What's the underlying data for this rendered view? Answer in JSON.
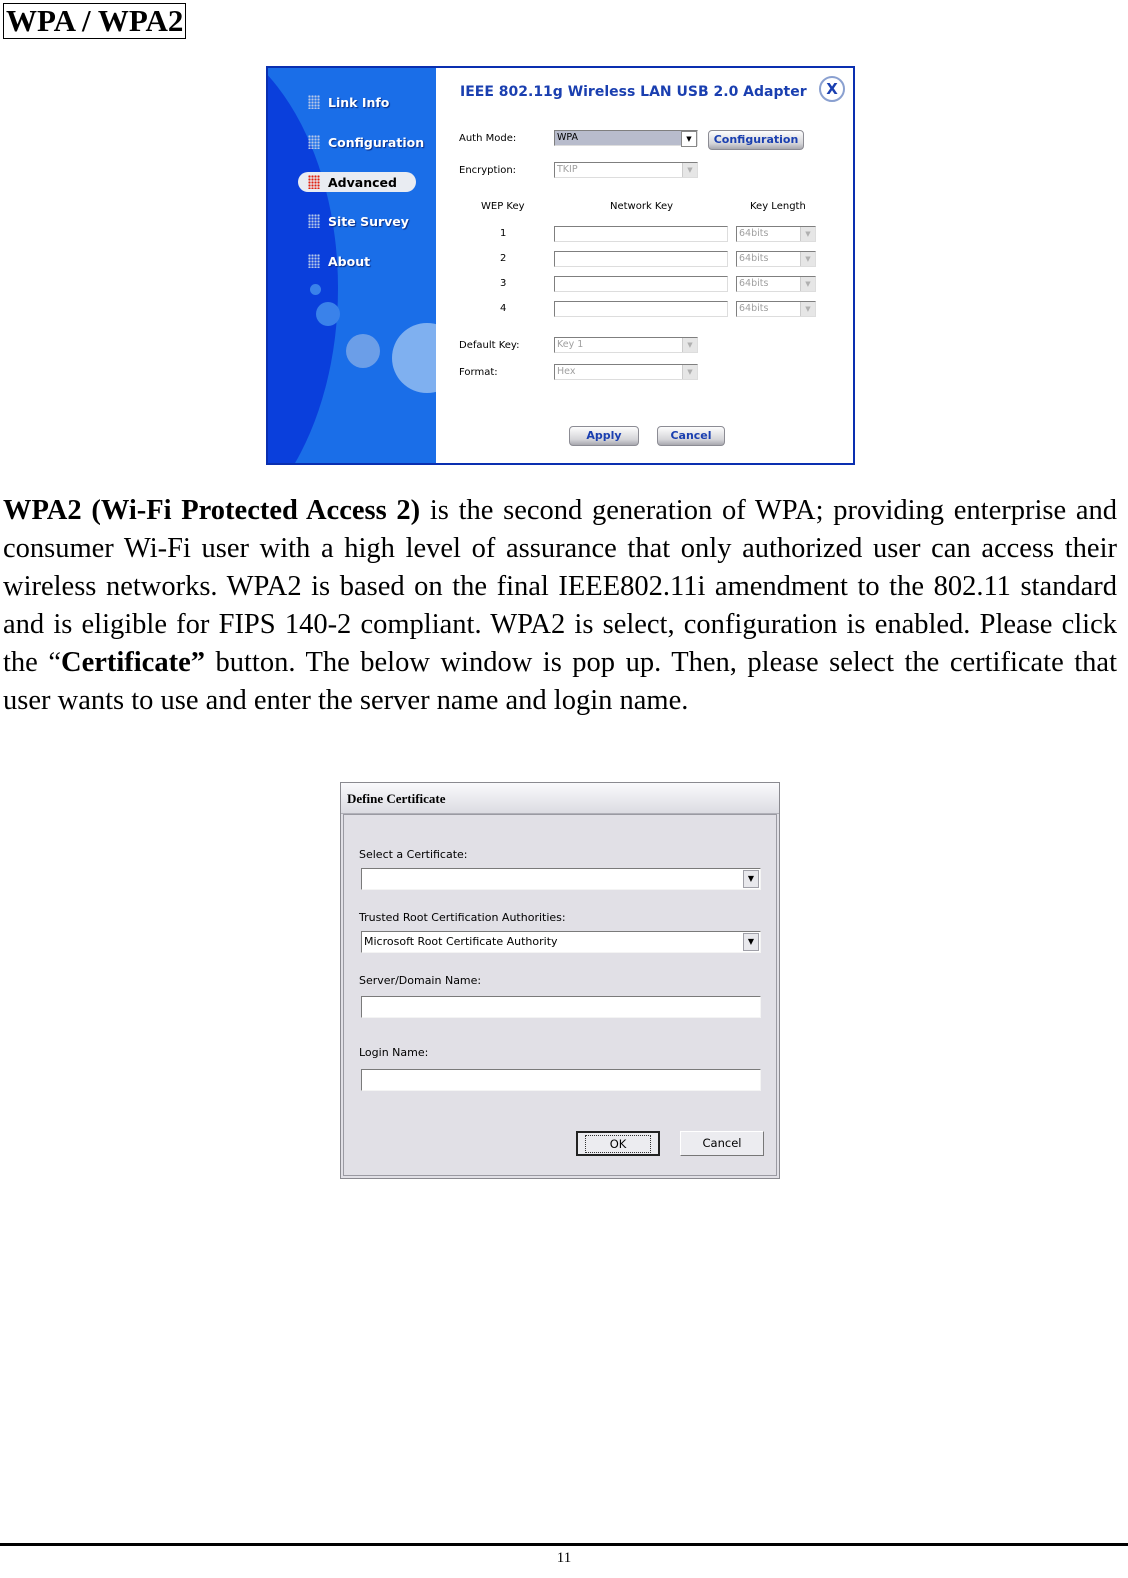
{
  "section_title": "WPA / WPA2",
  "utility": {
    "title": "IEEE 802.11g Wireless LAN USB 2.0 Adapter",
    "close_label": "X",
    "nav": [
      {
        "label": "Link Info",
        "active": false
      },
      {
        "label": "Configuration",
        "active": false
      },
      {
        "label": "Advanced",
        "active": true
      },
      {
        "label": "Site Survey",
        "active": false
      },
      {
        "label": "About",
        "active": false
      }
    ],
    "auth_mode_label": "Auth Mode:",
    "auth_mode_value": "WPA",
    "configuration_button": "Configuration",
    "encryption_label": "Encryption:",
    "encryption_value": "TKIP",
    "wep_headers": {
      "wep_key": "WEP Key",
      "network_key": "Network Key",
      "key_length": "Key Length"
    },
    "wep_rows": [
      {
        "index": "1",
        "network_key": "",
        "key_length": "64bits"
      },
      {
        "index": "2",
        "network_key": "",
        "key_length": "64bits"
      },
      {
        "index": "3",
        "network_key": "",
        "key_length": "64bits"
      },
      {
        "index": "4",
        "network_key": "",
        "key_length": "64bits"
      }
    ],
    "default_key_label": "Default Key:",
    "default_key_value": "Key 1",
    "format_label": "Format:",
    "format_value": "Hex",
    "apply_button": "Apply",
    "cancel_button": "Cancel"
  },
  "paragraph": {
    "bold_intro": "WPA2 (Wi-Fi Protected Access 2)",
    "text_1": " is the second generation of WPA; providing enterprise and consumer Wi-Fi user with a high level of assurance that only authorized user can access their wireless networks. WPA2 is based on the final IEEE802.11i amendment to the 802.11 standard and is eligible for FIPS 140-2 compliant. WPA2 is select, configuration is enabled.  Please click the “",
    "bold_certificate": "Certificate”",
    "text_2": " button. The below window is pop up. Then, please select the certificate that user wants to use and enter the server name and login name."
  },
  "certificate_dialog": {
    "title": "Define Certificate",
    "select_cert_label": "Select a Certificate:",
    "select_cert_value": "",
    "trusted_root_label": "Trusted Root Certification Authorities:",
    "trusted_root_value": "Microsoft Root Certificate Authority",
    "server_label": "Server/Domain Name:",
    "server_value": "",
    "login_label": "Login Name:",
    "login_value": "",
    "ok_button": "OK",
    "cancel_button": "Cancel"
  },
  "page_number": "11"
}
